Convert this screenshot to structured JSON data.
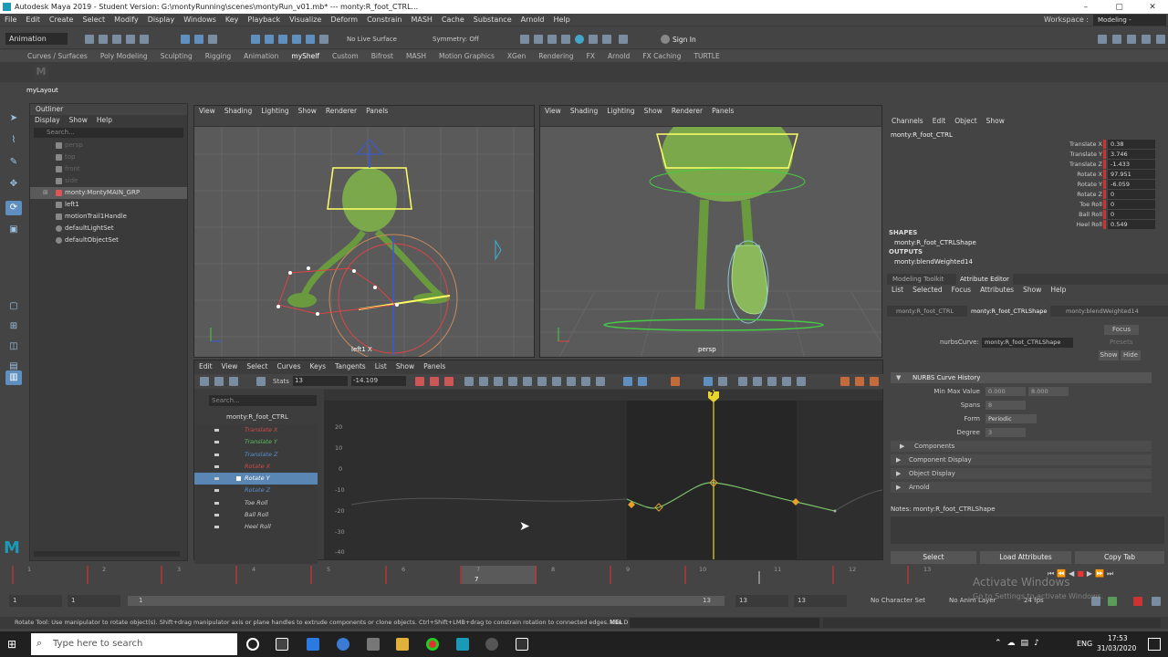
{
  "title_bar": {
    "title": "Autodesk Maya 2019 - Student Version: G:\\montyRunning\\scenes\\montyRun_v01.mb*  ---  monty:R_foot_CTRL...",
    "min": "–",
    "max": "▢",
    "close": "✕"
  },
  "menu_bar": {
    "items": [
      "File",
      "Edit",
      "Create",
      "Select",
      "Modify",
      "Display",
      "Windows",
      "Key",
      "Playback",
      "Visualize",
      "Deform",
      "Constrain",
      "MASH",
      "Cache",
      "Substance",
      "Arnold",
      "Help"
    ],
    "workspace_label": "Workspace :",
    "workspace_value": "Modeling - Standard*"
  },
  "status_line": {
    "mode": "Animation",
    "live_surface": "No Live Surface",
    "symmetry": "Symmetry: Off",
    "sign_in": "Sign In"
  },
  "shelf": {
    "tabs": [
      "Curves / Surfaces",
      "Poly Modeling",
      "Sculpting",
      "Rigging",
      "Animation",
      "myShelf",
      "Custom",
      "Bifrost",
      "MASH",
      "Motion Graphics",
      "XGen",
      "Rendering",
      "FX",
      "Arnold",
      "FX Caching",
      "TURTLE"
    ],
    "active": "myShelf"
  },
  "workspace_tab": "myLayout",
  "outliner": {
    "title": "Outliner",
    "menu": [
      "Display",
      "Show",
      "Help"
    ],
    "search_placeholder": "Search...",
    "items": [
      {
        "label": "persp",
        "dim": true
      },
      {
        "label": "top",
        "dim": true
      },
      {
        "label": "front",
        "dim": true
      },
      {
        "label": "side",
        "dim": true
      },
      {
        "label": "monty:MontyMAIN_GRP",
        "dim": false,
        "selected": true
      },
      {
        "label": "left1",
        "dim": false
      },
      {
        "label": "motionTrail1Handle",
        "dim": false
      },
      {
        "label": "defaultLightSet",
        "dim": false
      },
      {
        "label": "defaultObjectSet",
        "dim": false
      }
    ]
  },
  "viewport_left": {
    "menu": [
      "View",
      "Shading",
      "Lighting",
      "Show",
      "Renderer",
      "Panels"
    ],
    "camera_label": "left1 X"
  },
  "viewport_right": {
    "menu": [
      "View",
      "Shading",
      "Lighting",
      "Show",
      "Renderer",
      "Panels"
    ],
    "camera_label": "persp"
  },
  "graph_editor": {
    "menu": [
      "Edit",
      "View",
      "Select",
      "Curves",
      "Keys",
      "Tangents",
      "List",
      "Show",
      "Panels"
    ],
    "stats_label": "Stats",
    "stats_val1": "13",
    "stats_val2": "-14.109",
    "search_placeholder": "Search...",
    "node": "monty:R_foot_CTRL",
    "channels": [
      {
        "label": "Translate X",
        "color": "#d24a4a"
      },
      {
        "label": "Translate Y",
        "color": "#5cbf5c"
      },
      {
        "label": "Translate Z",
        "color": "#5c8fd2"
      },
      {
        "label": "Rotate X",
        "color": "#d24a4a"
      },
      {
        "label": "Rotate Y",
        "color": "#ffffff",
        "selected": true
      },
      {
        "label": "Rotate Z",
        "color": "#5c8fd2"
      },
      {
        "label": "Toe Roll",
        "color": "#dddddd"
      },
      {
        "label": "Ball Roll",
        "color": "#dddddd"
      },
      {
        "label": "Heel Roll",
        "color": "#dddddd"
      }
    ],
    "y_ticks": [
      "20",
      "10",
      "0",
      "-10",
      "-20",
      "-30",
      "-40"
    ],
    "current_frame": "7"
  },
  "channel_box": {
    "menu": [
      "Channels",
      "Edit",
      "Object",
      "Show"
    ],
    "node": "monty:R_foot_CTRL",
    "attrs": [
      {
        "label": "Translate X",
        "value": "0.38"
      },
      {
        "label": "Translate Y",
        "value": "3.746"
      },
      {
        "label": "Translate Z",
        "value": "-1.433"
      },
      {
        "label": "Rotate X",
        "value": "97.951"
      },
      {
        "label": "Rotate Y",
        "value": "-6.059"
      },
      {
        "label": "Rotate Z",
        "value": "0"
      },
      {
        "label": "Toe Roll",
        "value": "0"
      },
      {
        "label": "Ball Roll",
        "value": "0"
      },
      {
        "label": "Heel Roll",
        "value": "0.549"
      }
    ],
    "shapes_header": "SHAPES",
    "shape": "monty:R_foot_CTRLShape",
    "outputs_header": "OUTPUTS",
    "output": "monty:blendWeighted14"
  },
  "attribute_editor": {
    "tabs": [
      "Modeling Toolkit",
      "Attribute Editor"
    ],
    "menu": [
      "List",
      "Selected",
      "Focus",
      "Attributes",
      "Show",
      "Help"
    ],
    "node_tabs": [
      "monty:R_foot_CTRL",
      "monty:R_foot_CTRLShape",
      "monty:blendWeighted14"
    ],
    "type_label": "nurbsCurve:",
    "type_value": "monty:R_foot_CTRLShape",
    "focus": "Focus",
    "presets": "Presets",
    "show": "Show",
    "hide": "Hide",
    "section": "NURBS Curve History",
    "min_max_label": "Min Max Value",
    "min": "0.000",
    "max": "8.000",
    "spans_label": "Spans",
    "spans": "8",
    "form_label": "Form",
    "form": "Periodic",
    "degree_label": "Degree",
    "degree": "3",
    "collapsed": [
      "Components",
      "Component Display",
      "Object Display",
      "Arnold"
    ],
    "notes": "Notes: monty:R_foot_CTRLShape",
    "buttons": [
      "Select",
      "Load Attributes",
      "Copy Tab"
    ]
  },
  "time_slider": {
    "ticks": [
      "1",
      "2",
      "3",
      "4",
      "5",
      "6",
      "7",
      "8",
      "9",
      "10",
      "11",
      "12",
      "13"
    ],
    "current": "7"
  },
  "range_slider": {
    "start": "1",
    "inner_start": "1",
    "inner_end": "13",
    "end": "13",
    "end2": "13",
    "char_set": "No Character Set",
    "anim_layer": "No Anim Layer",
    "fps": "24 fps"
  },
  "help_line": {
    "text": "Rotate Tool: Use manipulator to rotate object(s). Shift+drag manipulator axis or plane handles to extrude components or clone objects. Ctrl+Shift+LMB+drag to constrain rotation to connected edges. Use D or INSERT",
    "mel": "MEL"
  },
  "watermark": {
    "title": "Activate Windows",
    "sub": "Go to Settings to activate Windows."
  },
  "taskbar": {
    "search_placeholder": "Type here to search",
    "lang": "ENG",
    "time": "17:53",
    "date": "31/03/2020"
  }
}
